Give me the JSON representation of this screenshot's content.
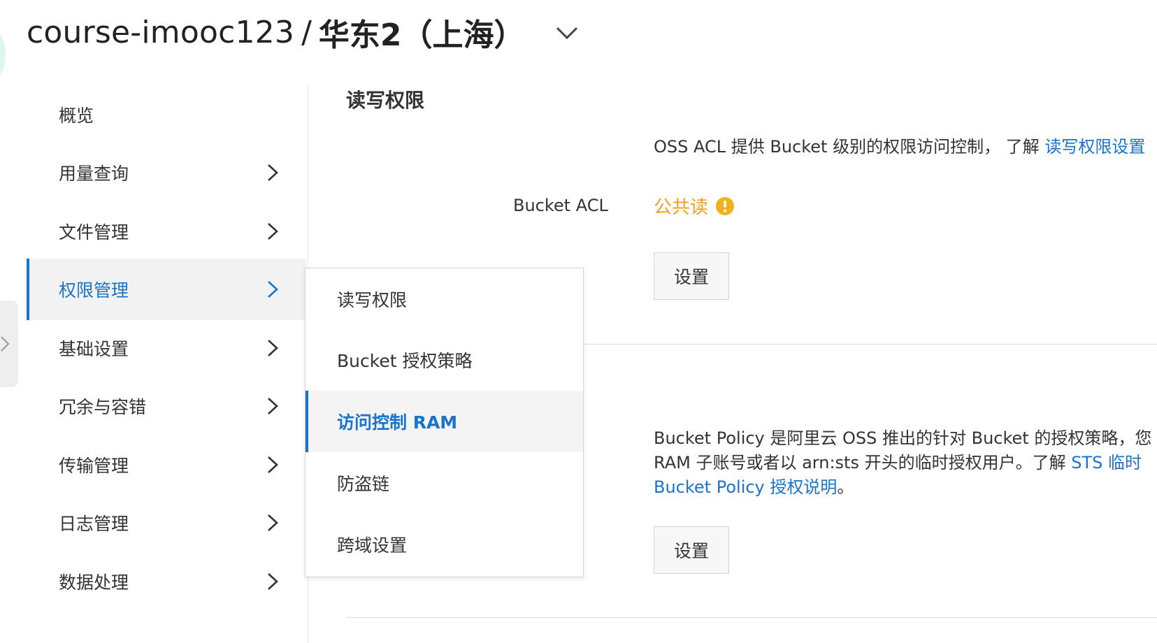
{
  "header": {
    "bucket_name": "course-imooc123",
    "separator": "/",
    "region": "华东2（上海）"
  },
  "sidebar": {
    "items": [
      {
        "label": "概览",
        "has_arrow": false
      },
      {
        "label": "用量查询",
        "has_arrow": true
      },
      {
        "label": "文件管理",
        "has_arrow": true
      },
      {
        "label": "权限管理",
        "has_arrow": true,
        "active": true
      },
      {
        "label": "基础设置",
        "has_arrow": true
      },
      {
        "label": "冗余与容错",
        "has_arrow": true
      },
      {
        "label": "传输管理",
        "has_arrow": true
      },
      {
        "label": "日志管理",
        "has_arrow": true
      },
      {
        "label": "数据处理",
        "has_arrow": true
      }
    ]
  },
  "submenu": {
    "items": [
      {
        "label": "读写权限"
      },
      {
        "label": "Bucket 授权策略"
      },
      {
        "label": "访问控制 RAM",
        "active": true
      },
      {
        "label": "防盗链"
      },
      {
        "label": "跨域设置"
      }
    ]
  },
  "main": {
    "section_title": "读写权限",
    "acl_description": "OSS ACL 提供 Bucket 级别的权限访问控制，  了解 ",
    "acl_link": "读写权限设置",
    "acl_label": "Bucket ACL",
    "acl_value": "公共读",
    "acl_set_button": "设置",
    "policy_line1": "Bucket Policy 是阿里云 OSS 推出的针对 Bucket 的授权策略，您",
    "policy_line2_text": "RAM 子账号或者以 arn:sts 开头的临时授权用户。了解 ",
    "policy_line2_link": "STS 临时",
    "policy_line3_link": "Bucket Policy 授权说明",
    "policy_line3_tail": "。",
    "policy_set_button": "设置"
  },
  "colors": {
    "accent": "#1a73cc",
    "warning": "#f0a020",
    "active_bg": "#f2f2f2"
  }
}
